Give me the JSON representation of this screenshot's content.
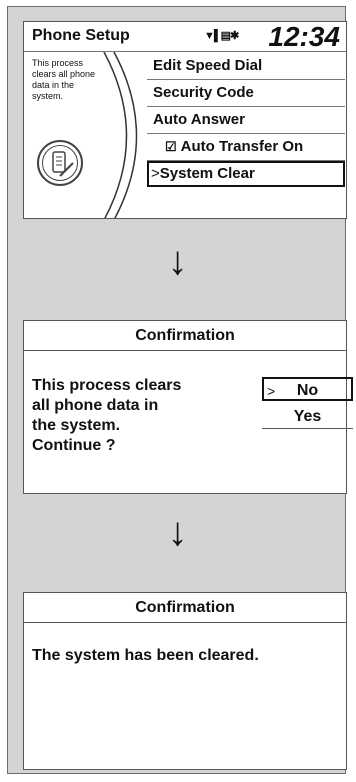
{
  "screen1": {
    "title": "Phone Setup",
    "status_icons": "▼▌▤✱",
    "clock": "12:34",
    "description": "This process clears all phone data in the system.",
    "menu": [
      {
        "label": "Edit Speed Dial"
      },
      {
        "label": "Security Code"
      },
      {
        "label": "Auto Answer"
      },
      {
        "label": "Auto Transfer On",
        "checked": true
      },
      {
        "label": "System Clear",
        "selected": true
      }
    ],
    "select_caret": ">"
  },
  "arrow_glyph": "↓",
  "screen2": {
    "title": "Confirmation",
    "body_lines": [
      "This process clears",
      "all phone data in",
      "the system.",
      "Continue ?"
    ],
    "no_label": "No",
    "yes_label": "Yes",
    "caret": ">"
  },
  "screen3": {
    "title": "Confirmation",
    "message": "The system has been cleared."
  }
}
